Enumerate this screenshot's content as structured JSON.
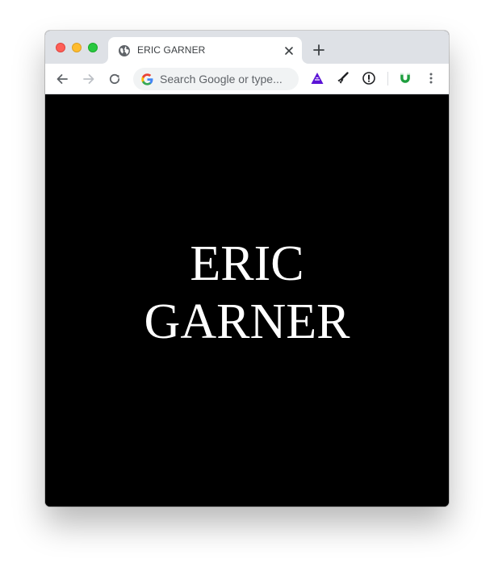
{
  "browser": {
    "tab": {
      "title": "ERIC GARNER",
      "favicon": "globe-icon"
    },
    "omnibox": {
      "placeholder": "Search Google or type..."
    },
    "toolbar": {
      "back_icon": "back-arrow-icon",
      "forward_icon": "forward-arrow-icon",
      "reload_icon": "reload-icon",
      "extensions": [
        "triangle-extension-icon",
        "paintbrush-extension-icon",
        "info-extension-icon",
        "magnet-extension-icon"
      ],
      "menu_icon": "kebab-menu-icon"
    },
    "colors": {
      "tabstrip": "#dee1e6",
      "page_background": "#000000",
      "page_text": "#ffffff"
    }
  },
  "page": {
    "headline_lines": [
      "ERIC",
      "GARNER"
    ]
  }
}
